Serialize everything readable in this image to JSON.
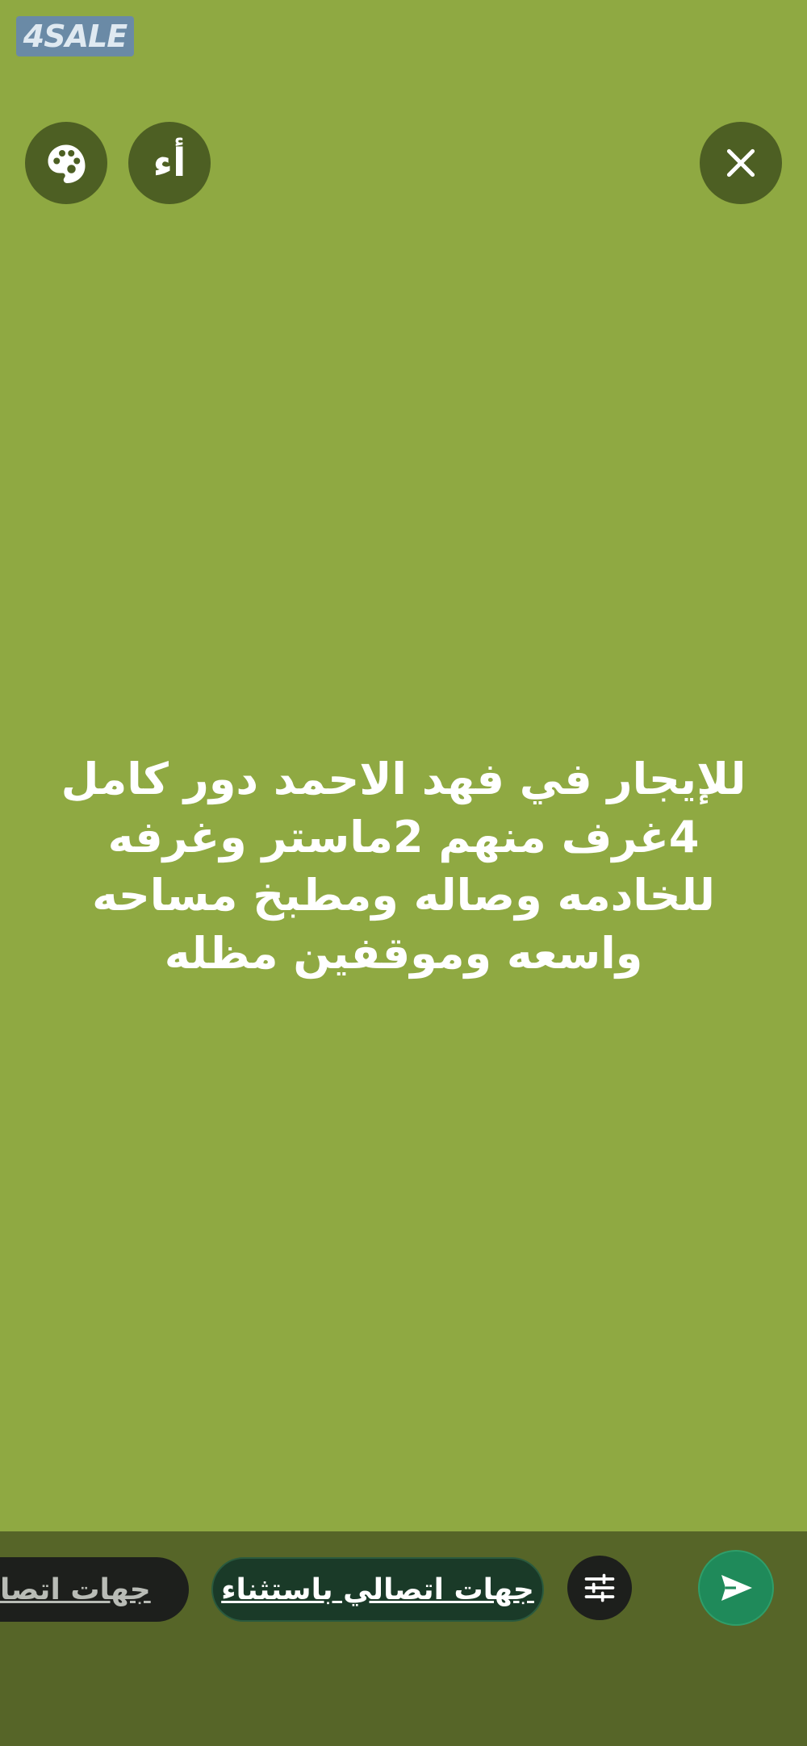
{
  "watermark": {
    "text": "4SALE"
  },
  "toolbar": {
    "font_label": "أء",
    "palette_icon": "palette-icon",
    "close_icon": "close-icon"
  },
  "story": {
    "text": "للإيجار في فهد الاحمد دور كامل 4غرف منهم 2ماستر وغرفه للخادمه وصاله ومطبخ مساحه واسعه وموقفين مظله"
  },
  "audience": {
    "except_label": "جهات اتصالي باستثناء",
    "contacts_label": "جهات اتصالي",
    "settings_icon": "sliders-icon",
    "send_icon": "send-icon"
  },
  "colors": {
    "background": "#8fa942",
    "bottom_bar": "#566528",
    "send": "#1f8a5a"
  }
}
